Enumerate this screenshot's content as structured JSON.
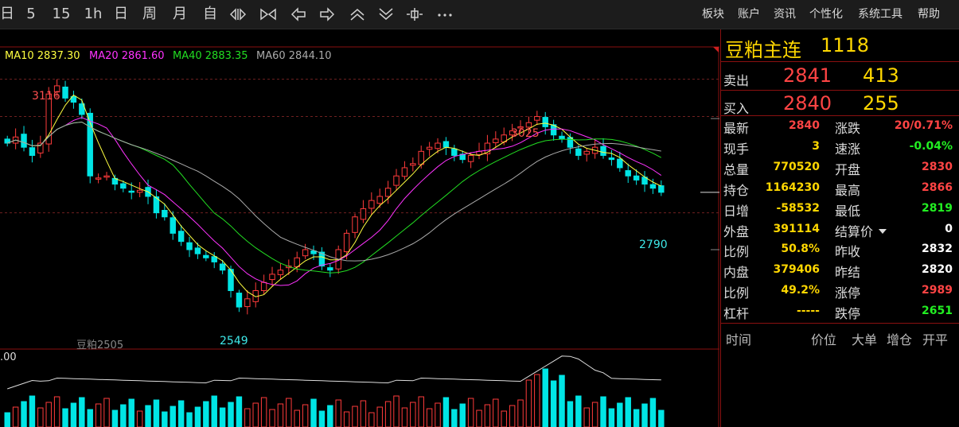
{
  "toolbar": {
    "periods": [
      "日",
      "5",
      "15",
      "1h",
      "日",
      "周",
      "月",
      "自"
    ],
    "menus": [
      "板块",
      "账户",
      "资讯",
      "个性化",
      "系统工具",
      "帮助"
    ]
  },
  "colors": {
    "up": "#ff3b3b",
    "down": "#00e5e5",
    "ma10": "#ffff40",
    "ma20": "#ff33ff",
    "ma40": "#22dd22",
    "ma60": "#aaaaaa",
    "accent": "#ffd700",
    "gain": "#ff4444",
    "loss": "#22ee22"
  },
  "ma": {
    "ma10": "MA10 2837.30",
    "ma20": "MA20 2861.60",
    "ma40": "MA40 2883.35",
    "ma60": "MA60 2844.10"
  },
  "chart": {
    "high_label": "3116",
    "low_label": "2549",
    "mid_high_label": "3025",
    "recent_low_label": "2790",
    "contract_label": "豆粕2505",
    "volume_scale": ".00"
  },
  "quote": {
    "title": "豆粕主连",
    "code": "1118",
    "sell_label": "卖出",
    "sell_price": "2841",
    "sell_vol": "413",
    "buy_label": "买入",
    "buy_price": "2840",
    "buy_vol": "255",
    "rows": [
      {
        "l1": "最新",
        "v1": "2840",
        "c1": "#ff4444",
        "l2": "涨跌",
        "v2": "20/0.71%",
        "c2": "#ff4444"
      },
      {
        "l1": "现手",
        "v1": "3",
        "c1": "#ffd700",
        "l2": "速涨",
        "v2": "-0.04%",
        "c2": "#22ee22"
      },
      {
        "l1": "总量",
        "v1": "770520",
        "c1": "#ffd700",
        "l2": "开盘",
        "v2": "2830",
        "c2": "#ff4444"
      },
      {
        "l1": "持仓",
        "v1": "1164230",
        "c1": "#ffd700",
        "l2": "最高",
        "v2": "2866",
        "c2": "#ff4444"
      },
      {
        "l1": "日增",
        "v1": "-58532",
        "c1": "#ffd700",
        "l2": "最低",
        "v2": "2819",
        "c2": "#22ee22"
      },
      {
        "l1": "外盘",
        "v1": "391114",
        "c1": "#ffd700",
        "l2": "结算价",
        "v2": "0",
        "c2": "#ffffff"
      },
      {
        "l1": "比例",
        "v1": "50.8%",
        "c1": "#ffd700",
        "l2": "昨收",
        "v2": "2832",
        "c2": "#ffffff"
      },
      {
        "l1": "内盘",
        "v1": "379406",
        "c1": "#ffd700",
        "l2": "昨结",
        "v2": "2820",
        "c2": "#ffffff"
      },
      {
        "l1": "比例",
        "v1": "49.2%",
        "c1": "#ffd700",
        "l2": "涨停",
        "v2": "2989",
        "c2": "#ff4444"
      },
      {
        "l1": "杠杆",
        "v1": "-----",
        "c1": "#ffd700",
        "l2": "跌停",
        "v2": "2651",
        "c2": "#22ee22"
      }
    ],
    "trade_headers": [
      "时间",
      "价位",
      "大单",
      "增仓",
      "开平"
    ]
  },
  "chart_data": {
    "type": "candlestick",
    "title": "豆粕2505",
    "labels": {
      "max": "3116",
      "min": "2549",
      "peak2": "3025",
      "low2": "2790"
    },
    "ylim": [
      2500,
      3160
    ],
    "close_series": [
      2960,
      2975,
      2950,
      2930,
      2960,
      3080,
      3100,
      3070,
      3060,
      3030,
      2880,
      2875,
      2880,
      2860,
      2850,
      2840,
      2845,
      2830,
      2790,
      2780,
      2740,
      2720,
      2700,
      2690,
      2680,
      2670,
      2650,
      2600,
      2560,
      2580,
      2600,
      2620,
      2640,
      2650,
      2660,
      2680,
      2700,
      2690,
      2660,
      2650,
      2700,
      2740,
      2780,
      2800,
      2820,
      2830,
      2850,
      2880,
      2900,
      2910,
      2940,
      2950,
      2960,
      2950,
      2930,
      2920,
      2930,
      2940,
      2960,
      2970,
      2980,
      2990,
      3000,
      3010,
      3025,
      3000,
      2980,
      2970,
      2950,
      2930,
      2940,
      2950,
      2930,
      2920,
      2900,
      2880,
      2870,
      2860,
      2850,
      2840
    ]
  }
}
